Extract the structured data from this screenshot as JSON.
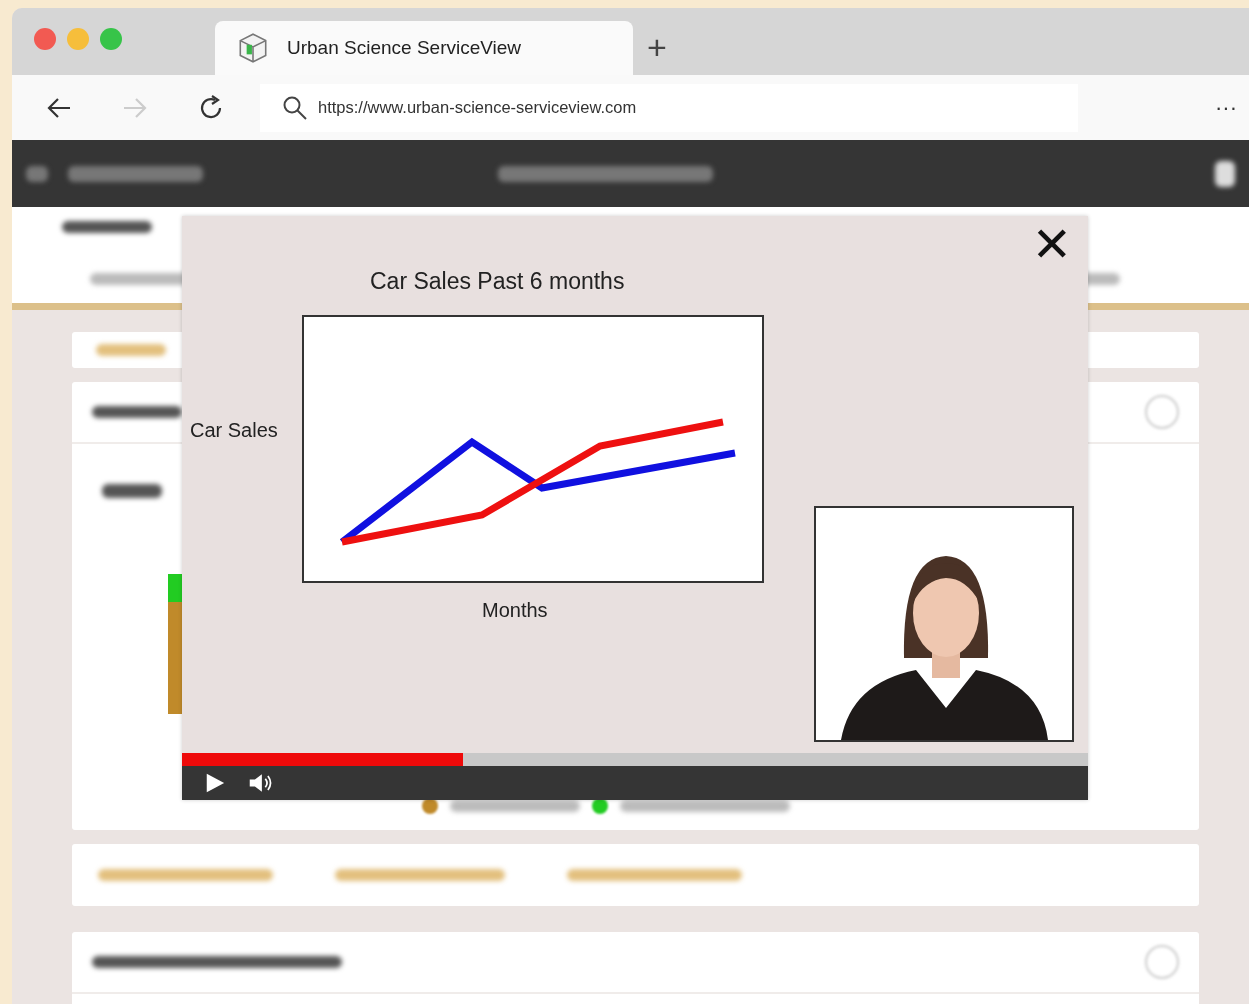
{
  "browser": {
    "tab_title": "Urban Science ServiceView",
    "new_tab": "+",
    "url": "https://www.urban-science-serviceview.com",
    "menu": "···"
  },
  "video_modal": {
    "close": "✕",
    "chart_title": "Car Sales Past 6 months",
    "ylabel": "Car Sales",
    "xlabel": "Months",
    "progress": {
      "level": 0.31
    }
  }
}
